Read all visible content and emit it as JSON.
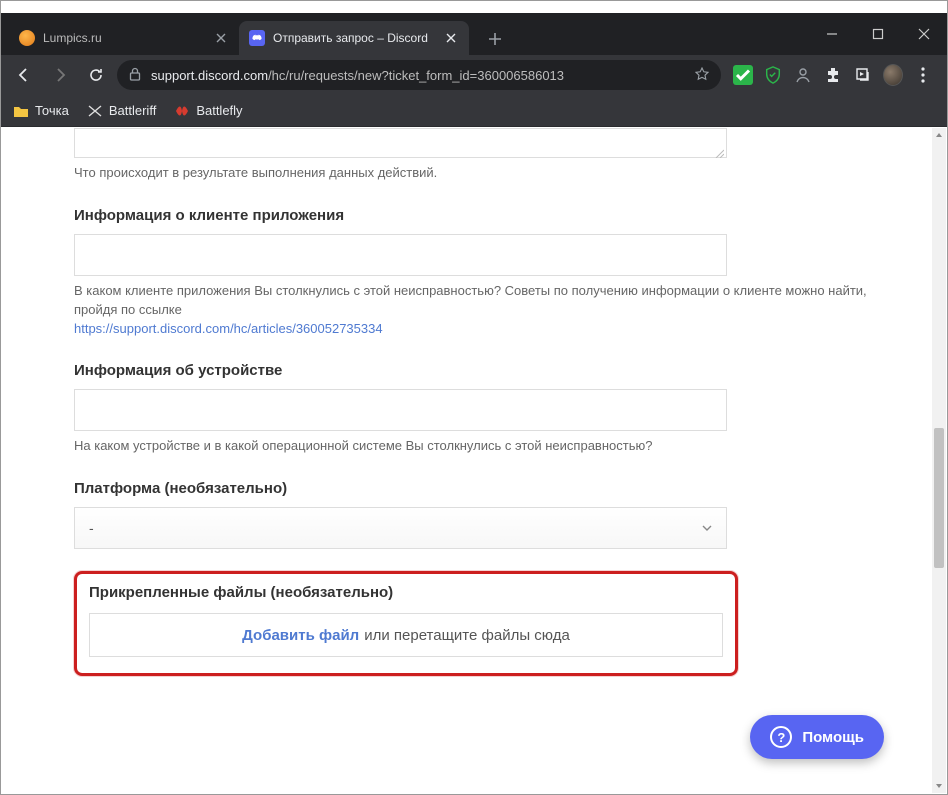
{
  "tabs": [
    {
      "title": "Lumpics.ru"
    },
    {
      "title": "Отправить запрос – Discord"
    }
  ],
  "url_host": "support.discord.com",
  "url_path": "/hc/ru/requests/new?ticket_form_id=360006586013",
  "bookmarks": [
    {
      "label": "Точка"
    },
    {
      "label": "Battleriff"
    },
    {
      "label": "Battlefly"
    }
  ],
  "form": {
    "result_help": "Что происходит в результате выполнения данных действий.",
    "client_label": "Информация о клиенте приложения",
    "client_help1": "В каком клиенте приложения Вы столкнулись с этой неисправностью? Советы по получению информации о клиенте можно найти, пройдя по ссылке",
    "client_help_link": "https://support.discord.com/hc/articles/360052735334",
    "device_label": "Информация об устройстве",
    "device_help": "На каком устройстве и в какой операционной системе Вы столкнулись с этой неисправностью?",
    "platform_label": "Платформа (необязательно)",
    "platform_value": "-",
    "attach_label": "Прикрепленные файлы (необязательно)",
    "attach_add": "Добавить файл",
    "attach_rest": " или перетащите файлы сюда"
  },
  "help_widget": "Помощь"
}
